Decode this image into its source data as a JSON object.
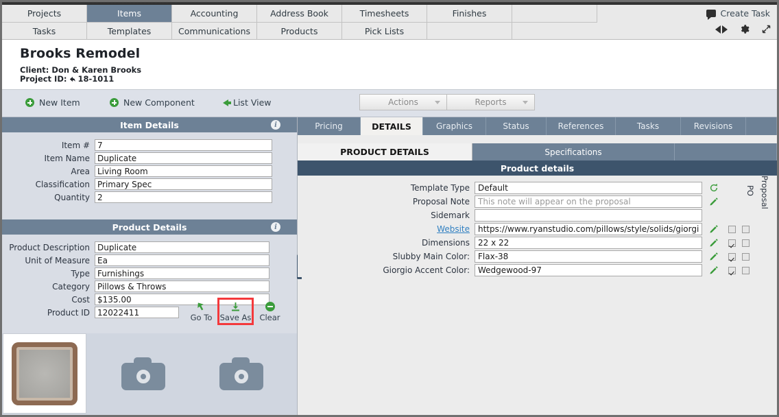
{
  "topnav": {
    "row1": [
      "Projects",
      "Items",
      "Accounting",
      "Address Book",
      "Timesheets",
      "Finishes"
    ],
    "row2": [
      "Tasks",
      "Templates",
      "Communications",
      "Products",
      "Pick Lists"
    ],
    "active_row1": "Items",
    "create_task": "Create Task",
    "icons": [
      "speech-bubble-icon",
      "prev-icon",
      "next-icon",
      "gear-icon",
      "expand-icon"
    ]
  },
  "project": {
    "title": "Brooks Remodel",
    "client_line": "Client: Don & Karen Brooks",
    "project_id_label": "Project ID:",
    "project_id": "18-1011"
  },
  "actionbar": {
    "new_item": "New Item",
    "new_component": "New Component",
    "list_view": "List View",
    "actions": "Actions",
    "reports": "Reports"
  },
  "item_details": {
    "header": "Item Details",
    "fields": [
      {
        "label": "Item #",
        "value": "7"
      },
      {
        "label": "Item Name",
        "value": "Duplicate"
      },
      {
        "label": "Area",
        "value": "Living Room"
      },
      {
        "label": "Classification",
        "value": "Primary Spec"
      },
      {
        "label": "Quantity",
        "value": "2"
      }
    ]
  },
  "product_details_left": {
    "header": "Product Details",
    "fields": [
      {
        "label": "Product Description",
        "value": "Duplicate"
      },
      {
        "label": "Unit of Measure",
        "value": "Ea"
      },
      {
        "label": "Type",
        "value": "Furnishings"
      },
      {
        "label": "Category",
        "value": "Pillows & Throws"
      },
      {
        "label": "Cost",
        "value": "$135.00"
      }
    ],
    "product_id_label": "Product ID",
    "product_id_value": "12022411",
    "buttons": [
      {
        "label": "Go To",
        "icon": "go-to-arrow-icon",
        "highlighted": false
      },
      {
        "label": "Save As",
        "icon": "save-download-icon",
        "highlighted": true
      },
      {
        "label": "Clear",
        "icon": "clear-minus-icon",
        "highlighted": false
      }
    ],
    "highlight_color": "#f4393c"
  },
  "thumbnails": [
    {
      "name": "pillow-photo",
      "type": "image"
    },
    {
      "name": "empty-photo-slot",
      "type": "camera-placeholder"
    },
    {
      "name": "empty-photo-slot",
      "type": "camera-placeholder"
    }
  ],
  "right_tabs": {
    "items": [
      "Pricing",
      "DETAILS",
      "Graphics",
      "Status",
      "References",
      "Tasks",
      "Revisions"
    ],
    "active": "DETAILS"
  },
  "right_subtabs": {
    "items": [
      "PRODUCT DETAILS",
      "Specifications"
    ],
    "active": "PRODUCT DETAILS"
  },
  "product_details_right": {
    "section_title": "Product details",
    "col_po": "PO",
    "col_proposal": "Proposal",
    "rows": [
      {
        "label": "Template Type",
        "value": "Default",
        "placeholder": "",
        "tool": "refresh-icon",
        "po": null,
        "proposal": null,
        "link": false
      },
      {
        "label": "Proposal Note",
        "value": "",
        "placeholder": "This note will appear on the proposal",
        "tool": "pencil-icon",
        "po": null,
        "proposal": null,
        "link": false
      },
      {
        "label": "Sidemark",
        "value": "",
        "placeholder": "",
        "tool": "",
        "po": null,
        "proposal": null,
        "link": false
      },
      {
        "label": "Website",
        "value": "https://www.ryanstudio.com/pillows/style/solids/giorgiolin",
        "placeholder": "",
        "tool": "pencil-icon",
        "po": false,
        "proposal": false,
        "link": true
      },
      {
        "label": "Dimensions",
        "value": "22 x 22",
        "placeholder": "",
        "tool": "pencil-icon",
        "po": true,
        "proposal": false,
        "link": false
      },
      {
        "label": "Slubby Main Color:",
        "value": "Flax-38",
        "placeholder": "",
        "tool": "pencil-icon",
        "po": true,
        "proposal": false,
        "link": false
      },
      {
        "label": "Giorgio Accent Color:",
        "value": "Wedgewood-97",
        "placeholder": "",
        "tool": "pencil-icon",
        "po": true,
        "proposal": false,
        "link": false
      }
    ]
  },
  "colors": {
    "nav_active": "#6d8196",
    "section_header": "#6d8196",
    "blue_bar": "#3d546c",
    "green_accent": "#3b9c3b",
    "link": "#2f7fc1",
    "highlight": "#f4393c"
  }
}
